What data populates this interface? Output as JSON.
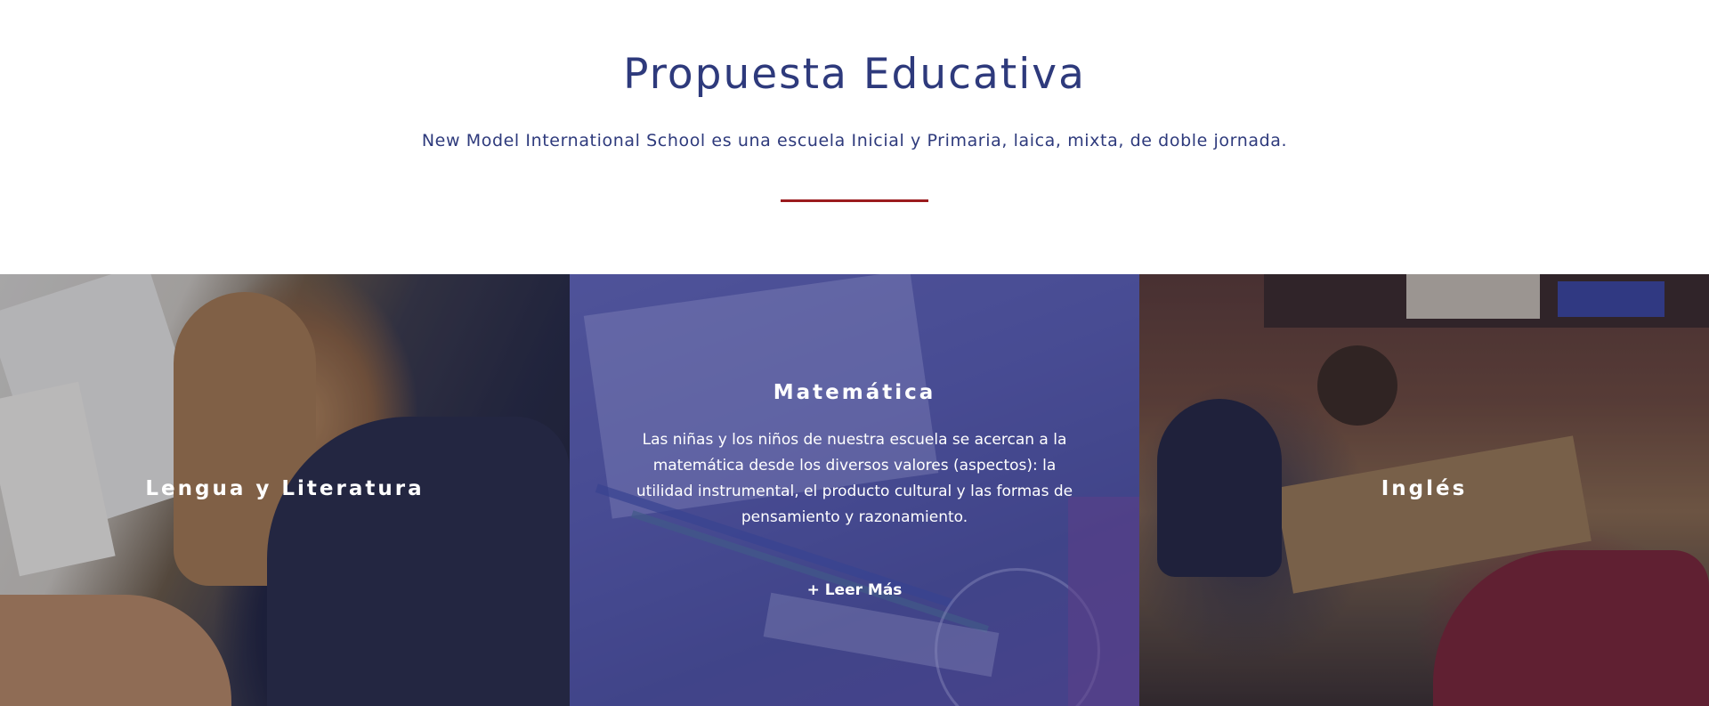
{
  "header": {
    "title": "Propuesta Educativa",
    "subtitle": "New Model International School es una escuela Inicial y Primaria, laica, mixta, de doble jornada."
  },
  "colors": {
    "title": "#2e3a7c",
    "divider": "#9b1b1e",
    "overlay": "#464896"
  },
  "cards": [
    {
      "title": "Lengua y Literatura"
    },
    {
      "title": "Matemática",
      "text": "Las niñas y los niños de nuestra escuela se acercan a la matemática desde los diversos valores (aspectos): la utilidad instrumental, el producto cultural y las formas de pensamiento y razonamiento.",
      "link": "+ Leer Más"
    },
    {
      "title": "Inglés"
    }
  ]
}
